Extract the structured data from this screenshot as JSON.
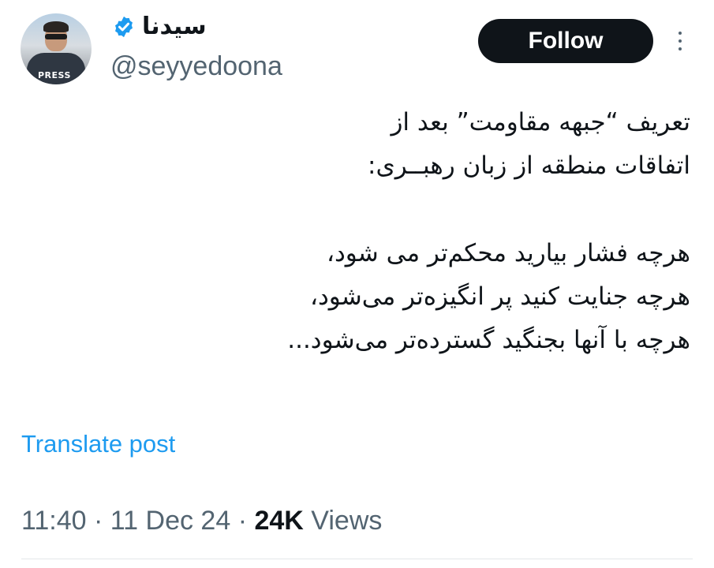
{
  "author": {
    "display_name": "سیدنا",
    "handle": "@seyyedoona",
    "avatar_badge": "PRESS",
    "verified_icon": "verified-badge-icon",
    "verified_color": "#1d9bf0"
  },
  "actions": {
    "follow_label": "Follow",
    "more_icon": "more-vertical-icon"
  },
  "tweet": {
    "lines": [
      "تعریف “جبهه مقاومت” بعد از",
      "اتفاقات منطقه از زبان رهبــری:",
      "",
      "هرچه فشار بیارید محکم‌تر می شود،",
      "هرچه جنایت کنید پر انگیزه‌تر می‌شود،",
      "هرچه با آنها بجنگید گسترده‌تر می‌شود..."
    ],
    "translate_label": "Translate post"
  },
  "meta": {
    "time": "11:40",
    "separator": " · ",
    "date": "11 Dec 24",
    "views_count": "24K",
    "views_label": "Views"
  },
  "colors": {
    "text_primary": "#0f1419",
    "text_secondary": "#536471",
    "link": "#1d9bf0",
    "follow_bg": "#0f1419"
  }
}
